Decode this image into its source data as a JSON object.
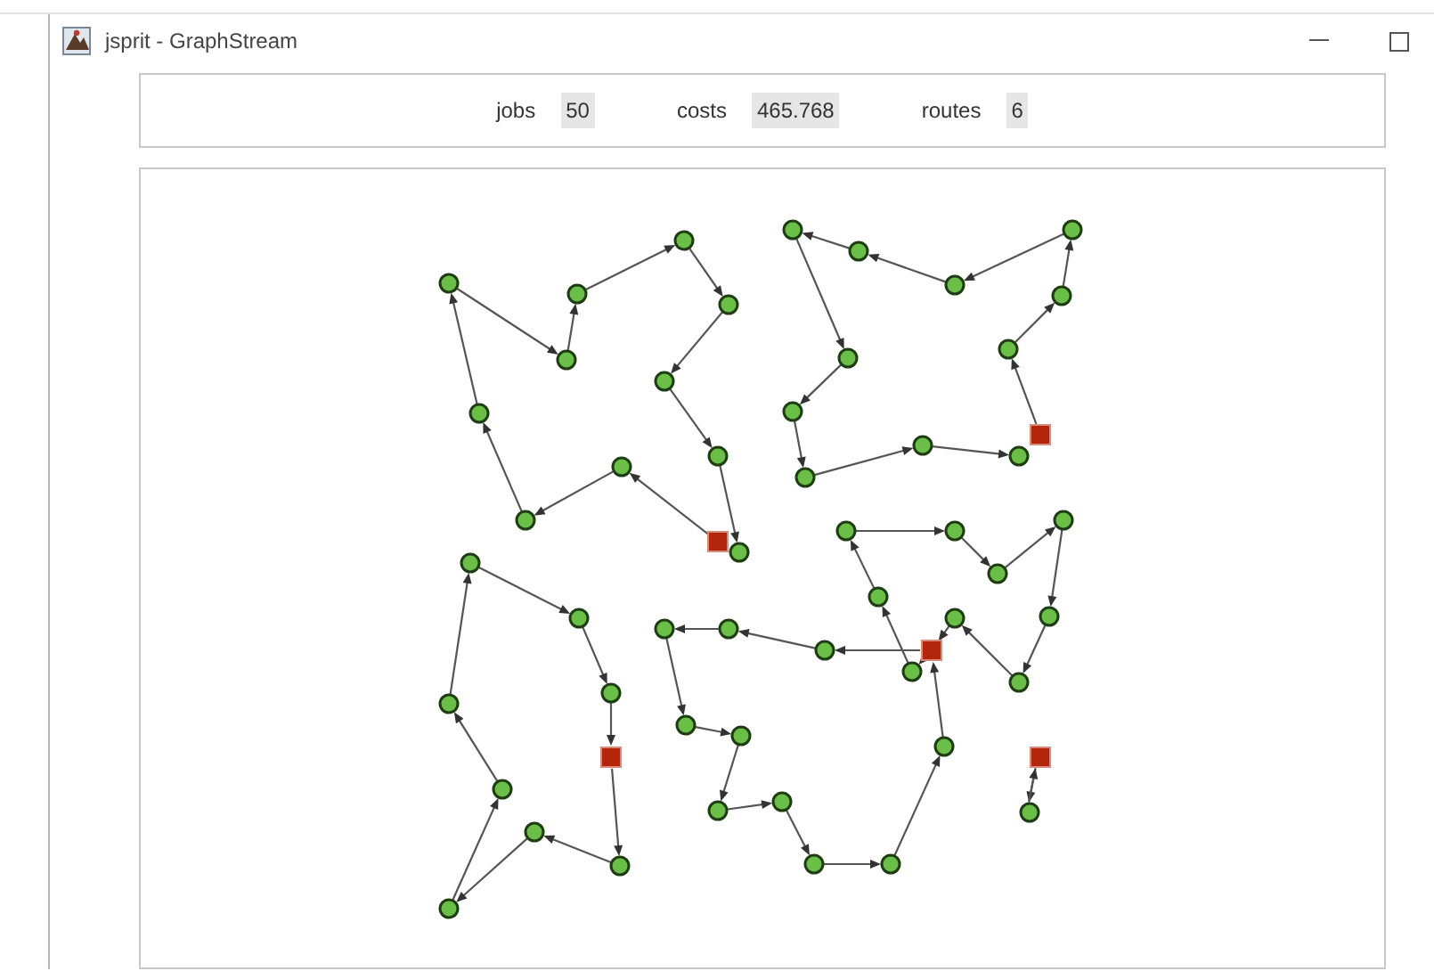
{
  "window": {
    "title": "jsprit - GraphStream"
  },
  "stats": [
    {
      "label": "jobs",
      "value": "50"
    },
    {
      "label": "costs",
      "value": "465.768"
    },
    {
      "label": "routes",
      "value": "6"
    }
  ],
  "graph": {
    "routes": [
      {
        "nodes": [
          {
            "kind": "depot"
          },
          {
            "kind": "job"
          },
          {
            "kind": "job"
          },
          {
            "kind": "job"
          },
          {
            "kind": "job"
          },
          {
            "kind": "job"
          },
          {
            "kind": "job"
          },
          {
            "kind": "job"
          },
          {
            "kind": "job"
          },
          {
            "kind": "job"
          },
          {
            "kind": "job"
          },
          {
            "kind": "job"
          }
        ]
      },
      {
        "nodes": [
          {
            "kind": "depot"
          },
          {
            "kind": "job"
          },
          {
            "kind": "job"
          },
          {
            "kind": "job"
          },
          {
            "kind": "job"
          },
          {
            "kind": "job"
          },
          {
            "kind": "job"
          },
          {
            "kind": "job"
          },
          {
            "kind": "job"
          },
          {
            "kind": "job"
          },
          {
            "kind": "job"
          },
          {
            "kind": "job"
          }
        ]
      },
      {
        "nodes": [
          {
            "kind": "depot"
          },
          {
            "kind": "job"
          },
          {
            "kind": "job"
          },
          {
            "kind": "job"
          },
          {
            "kind": "job"
          },
          {
            "kind": "job"
          },
          {
            "kind": "job"
          },
          {
            "kind": "job"
          },
          {
            "kind": "job"
          }
        ]
      },
      {
        "nodes": [
          {
            "kind": "depot"
          },
          {
            "kind": "job"
          },
          {
            "kind": "job"
          },
          {
            "kind": "job"
          },
          {
            "kind": "job"
          },
          {
            "kind": "job"
          },
          {
            "kind": "job"
          },
          {
            "kind": "job"
          },
          {
            "kind": "job"
          },
          {
            "kind": "job"
          },
          {
            "kind": "job"
          }
        ]
      },
      {
        "nodes": [
          {
            "kind": "depot"
          },
          {
            "kind": "job"
          },
          {
            "kind": "job"
          },
          {
            "kind": "job"
          },
          {
            "kind": "job"
          },
          {
            "kind": "job"
          },
          {
            "kind": "job"
          },
          {
            "kind": "job"
          },
          {
            "kind": "job"
          },
          {
            "kind": "job"
          }
        ]
      },
      {
        "nodes": [
          {
            "kind": "depot"
          },
          {
            "kind": "job"
          }
        ]
      }
    ]
  }
}
